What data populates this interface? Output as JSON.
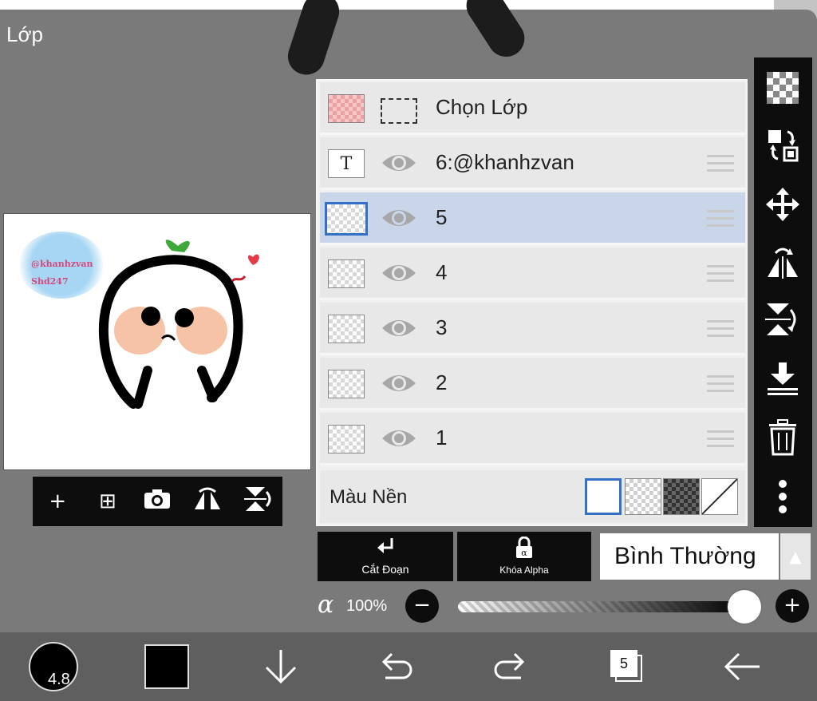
{
  "panel": {
    "title": "Lớp"
  },
  "preview": {
    "watermark_line1": "@khanhzvan",
    "watermark_line2": "Shd247",
    "tools": [
      {
        "name": "add-layer-icon",
        "glyph": "+"
      },
      {
        "name": "add-copy-layer-icon",
        "glyph": "⊞"
      },
      {
        "name": "camera-icon",
        "glyph": "📷"
      },
      {
        "name": "flip-horizontal-icon",
        "glyph": "⇋"
      },
      {
        "name": "flip-vertical-icon",
        "glyph": "⇵"
      }
    ]
  },
  "layers": {
    "select_row_label": "Chọn Lớp",
    "items": [
      {
        "name": "6:@khanhzvan",
        "type": "text",
        "selected": false
      },
      {
        "name": "5",
        "type": "raster",
        "selected": true
      },
      {
        "name": "4",
        "type": "raster",
        "selected": false
      },
      {
        "name": "3",
        "type": "raster",
        "selected": false
      },
      {
        "name": "2",
        "type": "raster",
        "selected": false
      },
      {
        "name": "1",
        "type": "raster",
        "selected": false
      }
    ],
    "background_label": "Màu Nền",
    "background_options": [
      "white",
      "transparent",
      "dark-checker",
      "none"
    ],
    "background_selected": "white",
    "text_thumb_glyph": "T"
  },
  "right_toolbar": [
    {
      "name": "transparency-icon"
    },
    {
      "name": "swap-layer-icon"
    },
    {
      "name": "move-icon"
    },
    {
      "name": "flip-layer-horizontal-icon"
    },
    {
      "name": "flip-layer-vertical-icon"
    },
    {
      "name": "merge-down-icon"
    },
    {
      "name": "trash-icon"
    },
    {
      "name": "more-icon"
    }
  ],
  "actions": {
    "clipping_label": "Cắt Đoạn",
    "alpha_lock_label": "Khóa Alpha",
    "blend_mode": "Bình Thường"
  },
  "opacity": {
    "symbol": "α",
    "value_label": "100%",
    "value": 100,
    "minus": "−",
    "plus": "+"
  },
  "bottom_bar": {
    "brush_size": "4.8",
    "current_color": "#000000",
    "layer_count": "5"
  },
  "colors": {
    "selection_blue": "#3470c7",
    "selected_row": "#c9d6ea",
    "toolbar_black": "#0d0d0d",
    "panel_gray": "#7a7a7a"
  }
}
